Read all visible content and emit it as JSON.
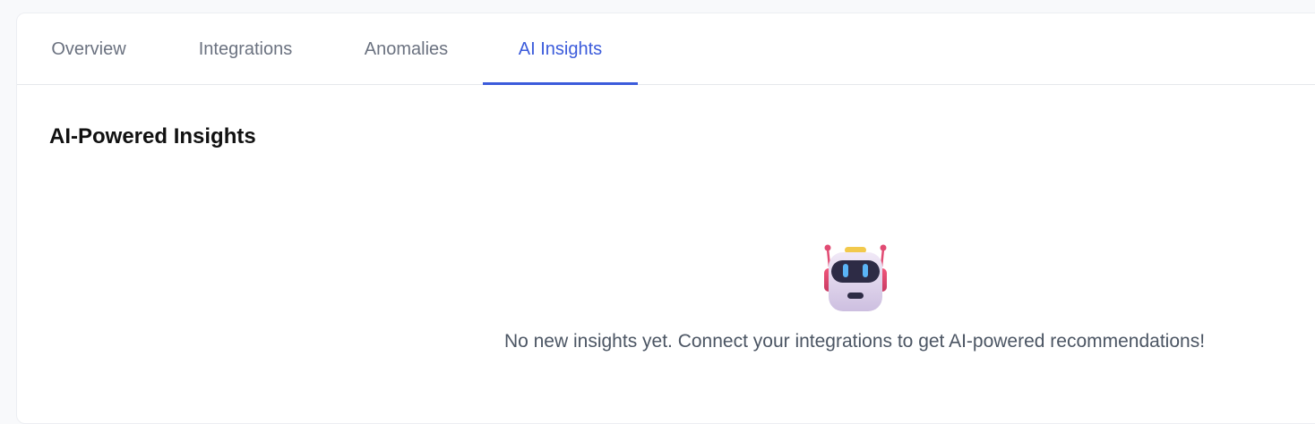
{
  "tabs": [
    {
      "label": "Overview",
      "active": false
    },
    {
      "label": "Integrations",
      "active": false
    },
    {
      "label": "Anomalies",
      "active": false
    },
    {
      "label": "AI Insights",
      "active": true
    }
  ],
  "section": {
    "title": "AI-Powered Insights"
  },
  "empty_state": {
    "icon": "robot-icon",
    "message": "No new insights yet. Connect your integrations to get AI-powered recommendations!"
  },
  "colors": {
    "accent": "#3b5bdb",
    "tab_inactive": "#6b7280",
    "text_muted": "#4b5563"
  }
}
